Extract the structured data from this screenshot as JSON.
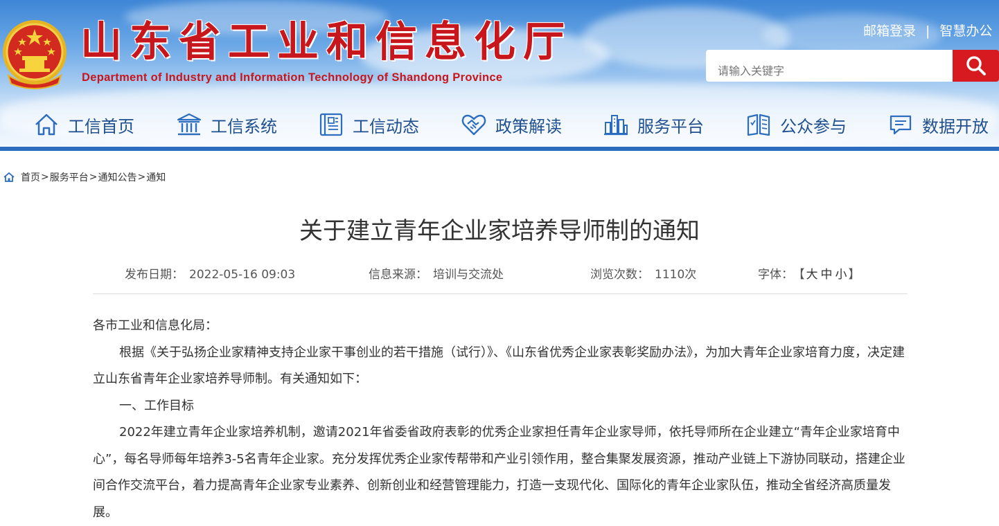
{
  "header": {
    "title": "山东省工业和信息化厅",
    "subtitle": "Department of Industry and Information Technology of Shandong Province",
    "links": [
      "邮箱登录",
      "智慧办公"
    ],
    "link_separator": "|",
    "search_placeholder": "请输入关键字",
    "accent_color": "#c8161d"
  },
  "nav": [
    {
      "label": "工信首页",
      "icon": "home-icon"
    },
    {
      "label": "工信系统",
      "icon": "building-icon"
    },
    {
      "label": "工信动态",
      "icon": "news-icon"
    },
    {
      "label": "政策解读",
      "icon": "handshake-icon"
    },
    {
      "label": "服务平台",
      "icon": "city-icon"
    },
    {
      "label": "公众参与",
      "icon": "book-icon"
    },
    {
      "label": "数据开放",
      "icon": "chat-icon"
    }
  ],
  "breadcrumb": [
    "首页",
    "服务平台",
    "通知公告",
    "通知"
  ],
  "breadcrumb_separator": ">",
  "article": {
    "title": "关于建立青年企业家培养导师制的通知",
    "meta": {
      "date_label": "发布日期：",
      "date": "2022-05-16 09:03",
      "source_label": "信息来源：",
      "source": "培训与交流处",
      "views_label": "浏览次数：",
      "views": "1110次",
      "font_label": "字体：",
      "font_open": "【",
      "font_sizes": [
        "大",
        "中",
        "小"
      ],
      "font_close": "】"
    },
    "paragraphs": [
      "各市工业和信息化局：",
      "根据《关于弘扬企业家精神支持企业家干事创业的若干措施（试行）》、《山东省优秀企业家表彰奖励办法》，为加大青年企业家培育力度，决定建立山东省青年企业家培养导师制。有关通知如下：",
      "一、工作目标",
      "2022年建立青年企业家培养机制，邀请2021年省委省政府表彰的优秀企业家担任青年企业家导师，依托导师所在企业建立“青年企业家培育中心”，每名导师每年培养3-5名青年企业家。充分发挥优秀企业家传帮带和产业引领作用，整合集聚发展资源，推动产业链上下游协同联动，搭建企业间合作交流平台，着力提高青年企业家专业素养、创新创业和经营管理能力，打造一支现代化、国际化的青年企业家队伍，推动全省经济高质量发展。"
    ]
  }
}
